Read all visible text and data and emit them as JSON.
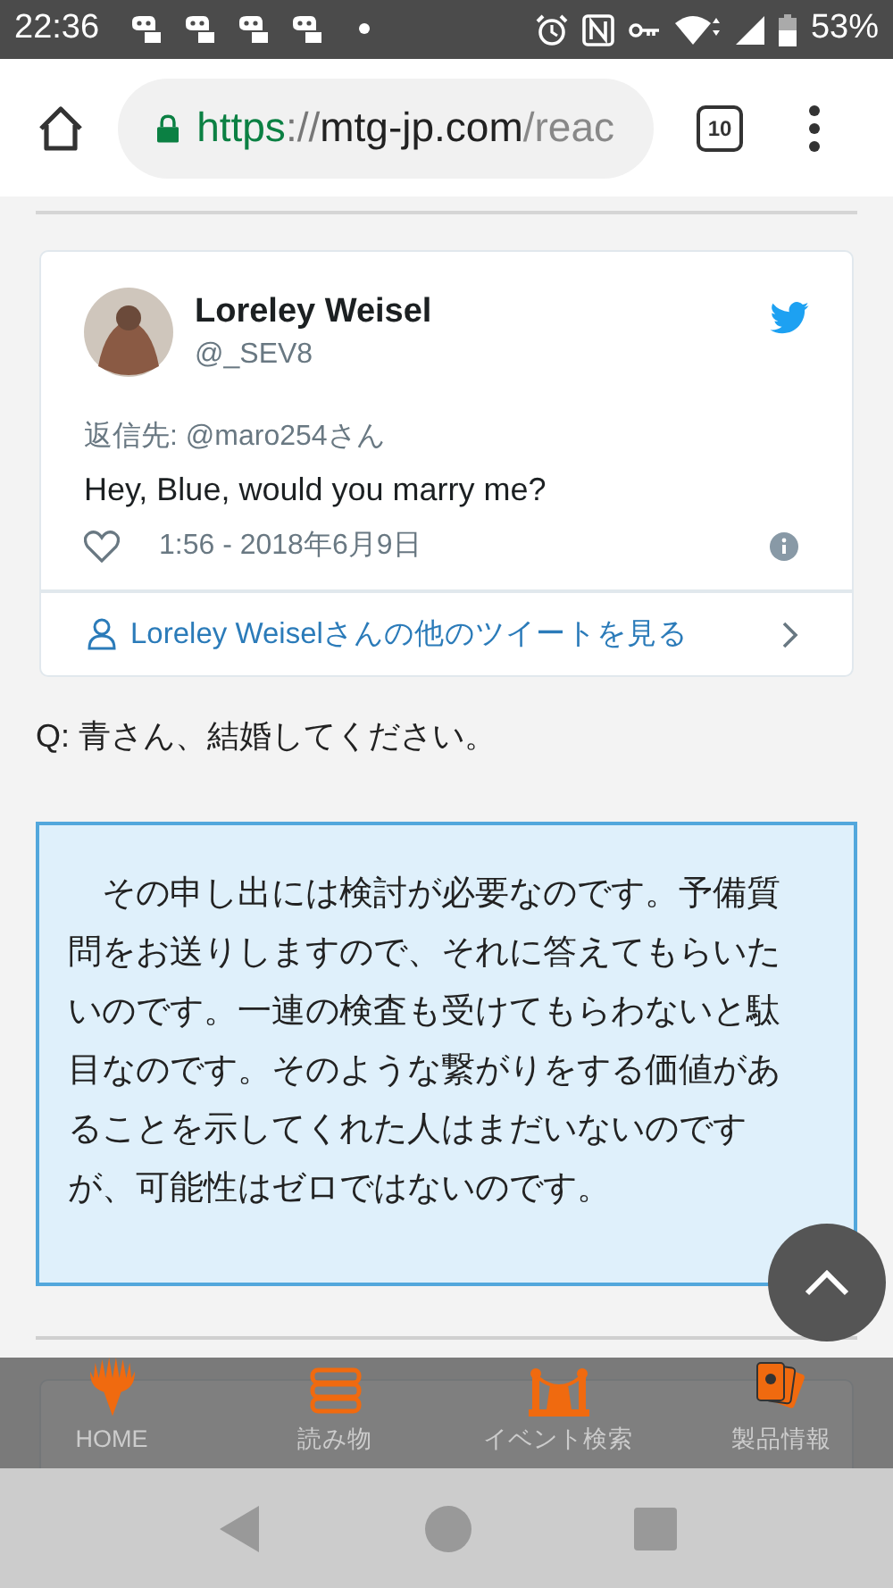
{
  "status_bar": {
    "time": "22:36",
    "battery": "53%"
  },
  "browser": {
    "url_scheme": "https",
    "url_sep": "://",
    "url_host": "mtg-jp.com",
    "url_path": "/reac",
    "tab_count": "10"
  },
  "tweet": {
    "name": "Loreley Weisel",
    "handle": "@_SEV8",
    "reply_to": "返信先: @maro254さん",
    "text": "Hey, Blue, would you marry me?",
    "time": "1:56 - 2018年6月9日",
    "more_link": "Loreley Weiselさんの他のツイートを見る"
  },
  "question": "Q: 青さん、結婚してください。",
  "answer": "その申し出には検討が必要なのです。予備質問をお送りしますので、それに答えてもらいたいのです。一連の検査も受けてもらわないと駄目なのです。そのような繋がりをする価値があることを示してくれた人はまだいないのですが、可能性はゼロではないのです。",
  "bottom_nav": [
    {
      "kind": "home",
      "label": "HOME"
    },
    {
      "kind": "reading",
      "label": "読み物"
    },
    {
      "kind": "event",
      "label": "イベント検索"
    },
    {
      "kind": "products",
      "label": "製品情報"
    }
  ]
}
